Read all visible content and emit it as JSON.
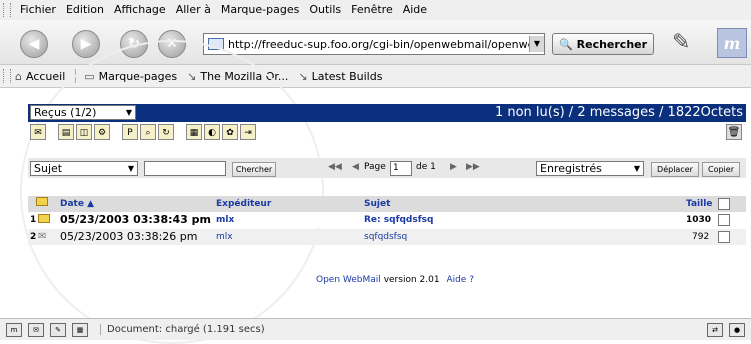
{
  "browser": {
    "menu": [
      "Fichier",
      "Edition",
      "Affichage",
      "Aller à",
      "Marque-pages",
      "Outils",
      "Fenêtre",
      "Aide"
    ],
    "url": "http://freeduc-sup.foo.org/cgi-bin/openwebmail/openwebm",
    "search_label": "Rechercher",
    "bookmarks": [
      "Accueil",
      "Marque-pages",
      "The Mozilla Or...",
      "Latest Builds"
    ],
    "status_text": "Document: chargé (1.191 secs)"
  },
  "webmail": {
    "folder": "Reçus (1/2)",
    "message_count": "1 non lu(s) / 2 messages / 1822Octets",
    "search_field": "Sujet",
    "search_button": "Chercher",
    "page_label": "Page",
    "page_value": "1",
    "page_of": "de 1",
    "target_folder": "Enregistrés",
    "move_button": "Déplacer",
    "copy_button": "Copier",
    "columns": {
      "date": "Date ▲",
      "from": "Expéditeur",
      "subject": "Sujet",
      "size": "Taille"
    },
    "messages": [
      {
        "num": "1",
        "date": "05/23/2003 03:38:43 pm",
        "from": "mlx",
        "subject": "Re: sqfqdsfsq",
        "size": "1030",
        "unread": true
      },
      {
        "num": "2",
        "date": "05/23/2003 03:38:26 pm",
        "from": "mlx",
        "subject": "sqfqdsfsq",
        "size": "792",
        "unread": false
      }
    ],
    "footer_app": "Open WebMail",
    "footer_version": "version 2.01",
    "footer_help": "Aide ?"
  },
  "colors": {
    "folder_bar": "#0a2f7c",
    "link": "#1a3aa6",
    "header_row": "#dcdcdc"
  }
}
